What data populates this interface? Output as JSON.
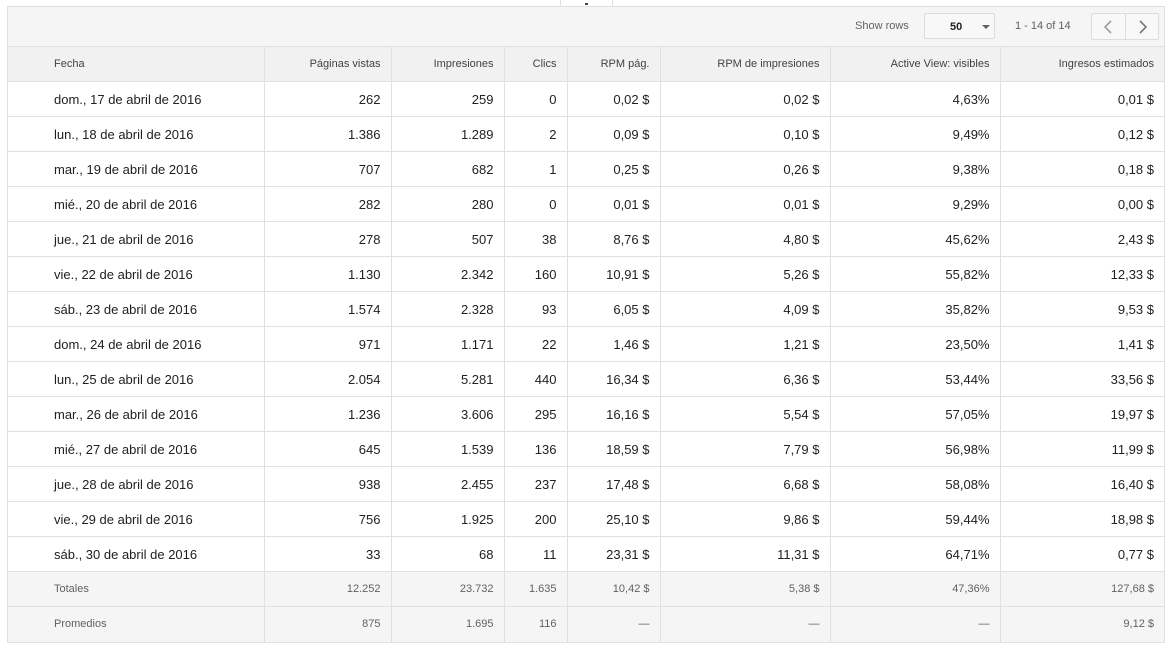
{
  "toolbar": {
    "show_rows_label": "Show rows",
    "rows_value": "50",
    "range_text": "1 - 14 of 14",
    "prev_icon": "chevron-left-icon",
    "next_icon": "chevron-right-icon"
  },
  "table": {
    "columns": [
      "Fecha",
      "Páginas vistas",
      "Impresiones",
      "Clics",
      "RPM pág.",
      "RPM de impresiones",
      "Active View: visibles",
      "Ingresos estimados"
    ],
    "rows": [
      [
        "dom., 17 de abril de 2016",
        "262",
        "259",
        "0",
        "0,02 $",
        "0,02 $",
        "4,63%",
        "0,01 $"
      ],
      [
        "lun., 18 de abril de 2016",
        "1.386",
        "1.289",
        "2",
        "0,09 $",
        "0,10 $",
        "9,49%",
        "0,12 $"
      ],
      [
        "mar., 19 de abril de 2016",
        "707",
        "682",
        "1",
        "0,25 $",
        "0,26 $",
        "9,38%",
        "0,18 $"
      ],
      [
        "mié., 20 de abril de 2016",
        "282",
        "280",
        "0",
        "0,01 $",
        "0,01 $",
        "9,29%",
        "0,00 $"
      ],
      [
        "jue., 21 de abril de 2016",
        "278",
        "507",
        "38",
        "8,76 $",
        "4,80 $",
        "45,62%",
        "2,43 $"
      ],
      [
        "vie., 22 de abril de 2016",
        "1.130",
        "2.342",
        "160",
        "10,91 $",
        "5,26 $",
        "55,82%",
        "12,33 $"
      ],
      [
        "sáb., 23 de abril de 2016",
        "1.574",
        "2.328",
        "93",
        "6,05 $",
        "4,09 $",
        "35,82%",
        "9,53 $"
      ],
      [
        "dom., 24 de abril de 2016",
        "971",
        "1.171",
        "22",
        "1,46 $",
        "1,21 $",
        "23,50%",
        "1,41 $"
      ],
      [
        "lun., 25 de abril de 2016",
        "2.054",
        "5.281",
        "440",
        "16,34 $",
        "6,36 $",
        "53,44%",
        "33,56 $"
      ],
      [
        "mar., 26 de abril de 2016",
        "1.236",
        "3.606",
        "295",
        "16,16 $",
        "5,54 $",
        "57,05%",
        "19,97 $"
      ],
      [
        "mié., 27 de abril de 2016",
        "645",
        "1.539",
        "136",
        "18,59 $",
        "7,79 $",
        "56,98%",
        "11,99 $"
      ],
      [
        "jue., 28 de abril de 2016",
        "938",
        "2.455",
        "237",
        "17,48 $",
        "6,68 $",
        "58,08%",
        "16,40 $"
      ],
      [
        "vie., 29 de abril de 2016",
        "756",
        "1.925",
        "200",
        "25,10 $",
        "9,86 $",
        "59,44%",
        "18,98 $"
      ],
      [
        "sáb., 30 de abril de 2016",
        "33",
        "68",
        "11",
        "23,31 $",
        "11,31 $",
        "64,71%",
        "0,77 $"
      ]
    ],
    "totals": [
      "Totales",
      "12.252",
      "23.732",
      "1.635",
      "10,42 $",
      "5,38 $",
      "47,36%",
      "127,68 $"
    ],
    "averages": [
      "Promedios",
      "875",
      "1.695",
      "116",
      "—",
      "—",
      "—",
      "9,12 $"
    ]
  }
}
